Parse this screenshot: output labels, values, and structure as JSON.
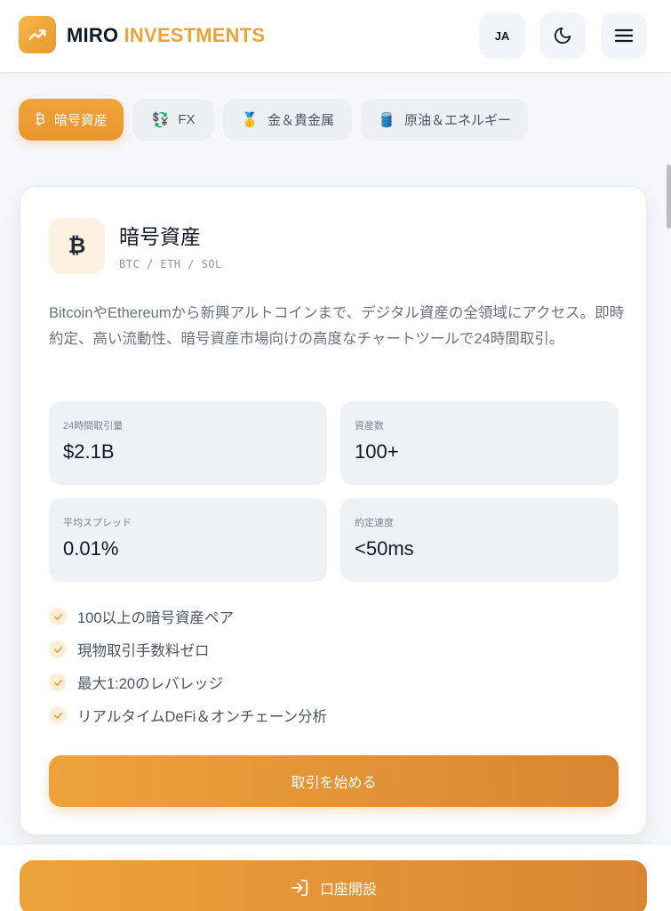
{
  "header": {
    "brand_part1": "MIRO",
    "brand_part2": "INVESTMENTS",
    "language": "JA"
  },
  "tabs": [
    {
      "icon": "₿",
      "label": "暗号資産",
      "active": true
    },
    {
      "icon": "💱",
      "label": "FX",
      "active": false
    },
    {
      "icon": "🥇",
      "label": "金＆貴金属",
      "active": false
    },
    {
      "icon": "🛢️",
      "label": "原油＆エネルギー",
      "active": false
    }
  ],
  "card": {
    "icon": "₿",
    "title": "暗号資産",
    "subtitle": "BTC / ETH / SOL",
    "description": "BitcoinやEthereumから新興アルトコインまで、デジタル資産の全領域にアクセス。即時約定、高い流動性、暗号資産市場向けの高度なチャートツールで24時間取引。",
    "stats": [
      {
        "label": "24時間取引量",
        "value": "$2.1B"
      },
      {
        "label": "資産数",
        "value": "100+"
      },
      {
        "label": "平均スプレッド",
        "value": "0.01%"
      },
      {
        "label": "約定速度",
        "value": "<50ms"
      }
    ],
    "features": [
      "100以上の暗号資産ペア",
      "現物取引手数料ゼロ",
      "最大1:20のレバレッジ",
      "リアルタイムDeFi＆オンチェーン分析"
    ],
    "cta_label": "取引を始める"
  },
  "bottom": {
    "open_account_label": "口座開設"
  },
  "colors": {
    "accent": "#e9a33a",
    "accent_dark": "#d98633",
    "check_bg": "#fdeed9"
  }
}
